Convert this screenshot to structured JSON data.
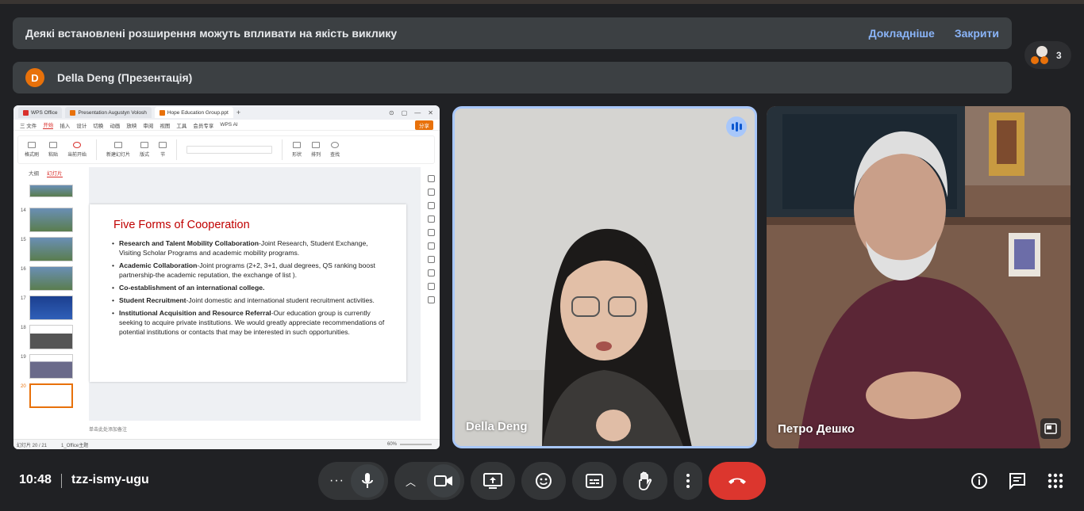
{
  "banner": {
    "message": "Деякі встановлені розширення можуть впливати на якість виклику",
    "more_label": "Докладніше",
    "close_label": "Закрити"
  },
  "presenter": {
    "initial": "D",
    "name": "Della Deng (Презентація)"
  },
  "participants": {
    "count": "3"
  },
  "shared_screen": {
    "tabs": [
      {
        "label": "WPS Office"
      },
      {
        "label": "Presentation Augustyn Volosh"
      },
      {
        "label": "Hope Education Group.ppt"
      }
    ],
    "menu": [
      "三 文件",
      "开始",
      "插入",
      "设计",
      "切换",
      "动画",
      "放映",
      "审阅",
      "视图",
      "工具",
      "会员专享",
      "WPS AI"
    ],
    "share_label": "分享",
    "ribbon": [
      "格式刷",
      "粘贴",
      "当前开始",
      "新建幻灯片",
      "版式",
      "节",
      "形状",
      "排列",
      "查找"
    ],
    "thumb_tabs": [
      "大纲",
      "幻灯片"
    ],
    "thumb_numbers": [
      "14",
      "15",
      "16",
      "17",
      "18",
      "19",
      "20"
    ],
    "slide": {
      "title": "Five Forms of Cooperation",
      "bullets": [
        {
          "bold": "Research and Talent Mobility Collaboration",
          "text": "-Joint Research, Student Exchange, Visiting Scholar Programs and academic mobility programs."
        },
        {
          "bold": "Academic Collaboration",
          "text": "-Joint programs (2+2, 3+1, dual degrees, QS ranking boost partnership-the academic reputation, the exchange of list )."
        },
        {
          "bold": "Co-establishment of an international college.",
          "text": ""
        },
        {
          "bold": "Student Recruitment",
          "text": "-Joint domestic and international student recruitment activities."
        },
        {
          "bold": "Institutional Acquisition and Resource Referral",
          "text": "-Our education group is currently seeking to acquire private institutions. We would greatly appreciate recommendations of potential institutions or contacts that may be interested in such opportunities."
        }
      ]
    },
    "notes": "单击此处添加备注",
    "status": {
      "slide_index": "幻灯片 20 / 21",
      "theme": "1_Office主题",
      "zoom": "60%"
    }
  },
  "tiles": [
    {
      "name": "Della Deng",
      "speaking": true
    },
    {
      "name": "Петро Дешко",
      "speaking": false
    }
  ],
  "footer": {
    "time": "10:48",
    "meeting_code": "tzz-ismy-ugu"
  },
  "colors": {
    "background": "#202124",
    "end_call": "#dc362e",
    "link": "#8ab4f8",
    "speaking_border": "#a8c7fa"
  }
}
